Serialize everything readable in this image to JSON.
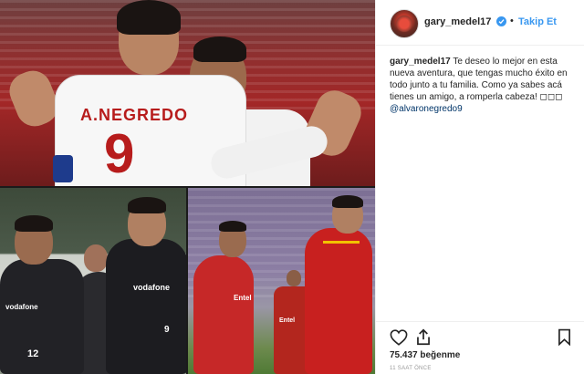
{
  "post": {
    "header": {
      "username": "gary_medel17",
      "verified": true,
      "separator": "•",
      "follow_label": "Takip Et"
    },
    "caption": {
      "username": "gary_medel17",
      "text": "Te deseo lo mejor en esta nueva aventura, que tengas mucho éxito en todo junto a tu familia. Como ya sabes acá tienes un amigo, a romperla cabeza! ◻◻◻",
      "mention": "@alvaronegredo9"
    },
    "likes": "75.437 beğenme",
    "timestamp": "11 SAAT ÖNCE"
  },
  "photos": {
    "top": {
      "jersey_name": "A.NEGREDO",
      "jersey_number": "9"
    },
    "bottom_left": {
      "sponsor": "vodafone",
      "number_left": "12",
      "number_right": "9"
    },
    "bottom_right": {
      "shirt_text_left": "Entel",
      "shirt_text_right": "Entel"
    }
  },
  "colors": {
    "accent": "#3897f0",
    "mention": "#003569",
    "divider": "#efefef",
    "jersey_red": "#b71c1c"
  },
  "icons": [
    "verified-badge-icon",
    "heart-icon",
    "share-icon",
    "bookmark-icon"
  ]
}
